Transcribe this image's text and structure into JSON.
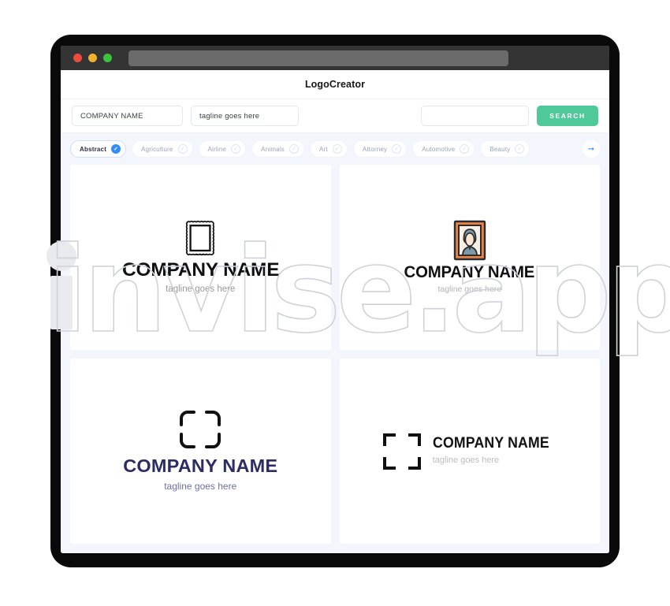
{
  "window": {
    "traffic_lights": [
      "close-red",
      "minimize-yellow",
      "maximize-green"
    ],
    "address_bar_value": "",
    "colors": {
      "bezel": "#0a0a0a",
      "titlebar": "#343434",
      "addressbar": "#6b6b6b",
      "red": "#ee4b3c",
      "yellow": "#f2b32c",
      "green": "#3cc33e"
    }
  },
  "app": {
    "title": "LogoCreator",
    "accent_green": "#50c99a",
    "accent_blue": "#2f8ff5",
    "background": "#f4f6fd"
  },
  "search": {
    "company_value": "COMPANY NAME",
    "company_placeholder": "COMPANY NAME",
    "tagline_value": "tagline goes here",
    "tagline_placeholder": "tagline goes here",
    "keyword_value": "",
    "keyword_placeholder": "",
    "button_label": "SEARCH"
  },
  "categories": {
    "next_arrow": "arrow-right-icon",
    "items": [
      {
        "label": "Abstract",
        "selected": true
      },
      {
        "label": "Agriculture",
        "selected": false
      },
      {
        "label": "Airline",
        "selected": false
      },
      {
        "label": "Animals",
        "selected": false
      },
      {
        "label": "Art",
        "selected": false
      },
      {
        "label": "Attorney",
        "selected": false
      },
      {
        "label": "Automotive",
        "selected": false
      },
      {
        "label": "Beauty",
        "selected": false
      }
    ]
  },
  "results": [
    {
      "icon": "ornate-picture-frame-icon",
      "name": "COMPANY NAME",
      "tagline": "tagline goes here",
      "layout": "stacked",
      "name_color": "#111111",
      "tagline_color": "#9a9a9a"
    },
    {
      "icon": "portrait-photo-frame-icon",
      "name": "COMPANY NAME",
      "tagline": "tagline goes here",
      "layout": "stacked",
      "name_color": "#111111",
      "tagline_color": "#b3b3b3"
    },
    {
      "icon": "rounded-crop-brackets-icon",
      "name": "COMPANY NAME",
      "tagline": "tagline goes here",
      "layout": "stacked",
      "name_color": "#2b2d63",
      "tagline_color": "#6c6fa5"
    },
    {
      "icon": "square-crop-brackets-icon",
      "name": "COMPANY NAME",
      "tagline": "tagline goes here",
      "layout": "horizontal",
      "name_color": "#121212",
      "tagline_color": "#bdbdbd"
    }
  ],
  "watermark": {
    "text": "invise.app"
  }
}
